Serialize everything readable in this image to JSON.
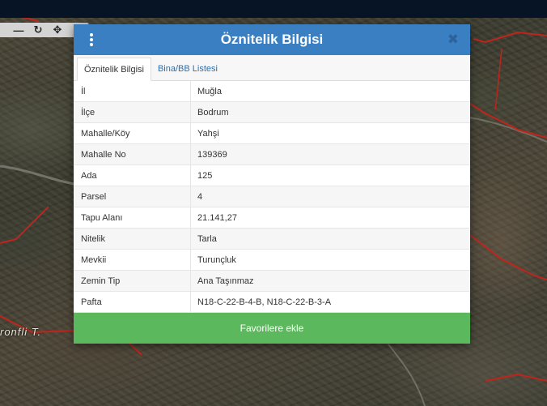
{
  "map": {
    "toolbar_icons": [
      "minus-icon",
      "refresh-icon",
      "move-icon"
    ],
    "place_label": "ronfli T."
  },
  "modal": {
    "title": "Öznitelik Bilgisi",
    "menu_icon": "vertical-dots-icon",
    "close_icon": "close-icon",
    "tabs": [
      {
        "label": "Öznitelik Bilgisi",
        "active": true
      },
      {
        "label": "Bina/BB Listesi",
        "active": false
      }
    ],
    "rows": [
      {
        "key": "İl",
        "value": "Muğla"
      },
      {
        "key": "İlçe",
        "value": "Bodrum"
      },
      {
        "key": "Mahalle/Köy",
        "value": "Yahşi"
      },
      {
        "key": "Mahalle No",
        "value": "139369"
      },
      {
        "key": "Ada",
        "value": "125"
      },
      {
        "key": "Parsel",
        "value": "4"
      },
      {
        "key": "Tapu Alanı",
        "value": "21.141,27"
      },
      {
        "key": "Nitelik",
        "value": "Tarla"
      },
      {
        "key": "Mevkii",
        "value": "Turunçluk"
      },
      {
        "key": "Zemin Tip",
        "value": "Ana Taşınmaz"
      },
      {
        "key": "Pafta",
        "value": "N18-C-22-B-4-B, N18-C-22-B-3-A"
      }
    ],
    "favorite_button": "Favorilere ekle"
  },
  "colors": {
    "header": "#3a7fc2",
    "button": "#5cb85c",
    "parcel_border": "#c0241c"
  }
}
